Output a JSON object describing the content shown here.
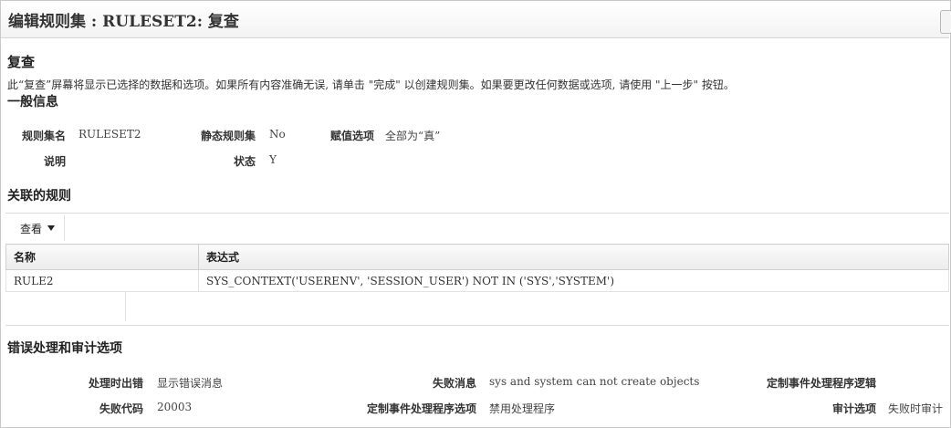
{
  "page": {
    "title": "编辑规则集 : RULESET2: 复查"
  },
  "review": {
    "title": "复查",
    "instructions": "此“复查”屏幕将显示已选择的数据和选项。如果所有内容准确无误, 请单击 \"完成\" 以创建规则集。如果要更改任何数据或选项, 请使用 \"上一步\" 按钮。"
  },
  "general": {
    "title": "一般信息",
    "ruleset_name_label": "规则集名",
    "ruleset_name_value": "RULESET2",
    "static_label": "静态规则集",
    "static_value": "No",
    "eval_label": "赋值选项",
    "eval_value": "全部为“真”",
    "desc_label": "说明",
    "desc_value": "",
    "status_label": "状态",
    "status_value": "Y"
  },
  "rules": {
    "title": "关联的规则",
    "view_menu": "查看",
    "columns": [
      "名称",
      "表达式"
    ],
    "rows": [
      [
        "RULE2",
        "SYS_CONTEXT('USERENV', 'SESSION_USER') NOT IN ('SYS','SYSTEM')"
      ]
    ]
  },
  "error": {
    "title": "错误处理和审计选项",
    "handling_label": "处理时出错",
    "handling_value": "显示错误消息",
    "fail_msg_label": "失败消息",
    "fail_msg_value": "sys and system can not create objects",
    "custom_logic_label": "定制事件处理程序逻辑",
    "custom_logic_value": "",
    "fail_code_label": "失败代码",
    "fail_code_value": "20003",
    "custom_opt_label": "定制事件处理程序选项",
    "custom_opt_value": "禁用处理程序",
    "audit_label": "审计选项",
    "audit_value": "失败时审计"
  }
}
